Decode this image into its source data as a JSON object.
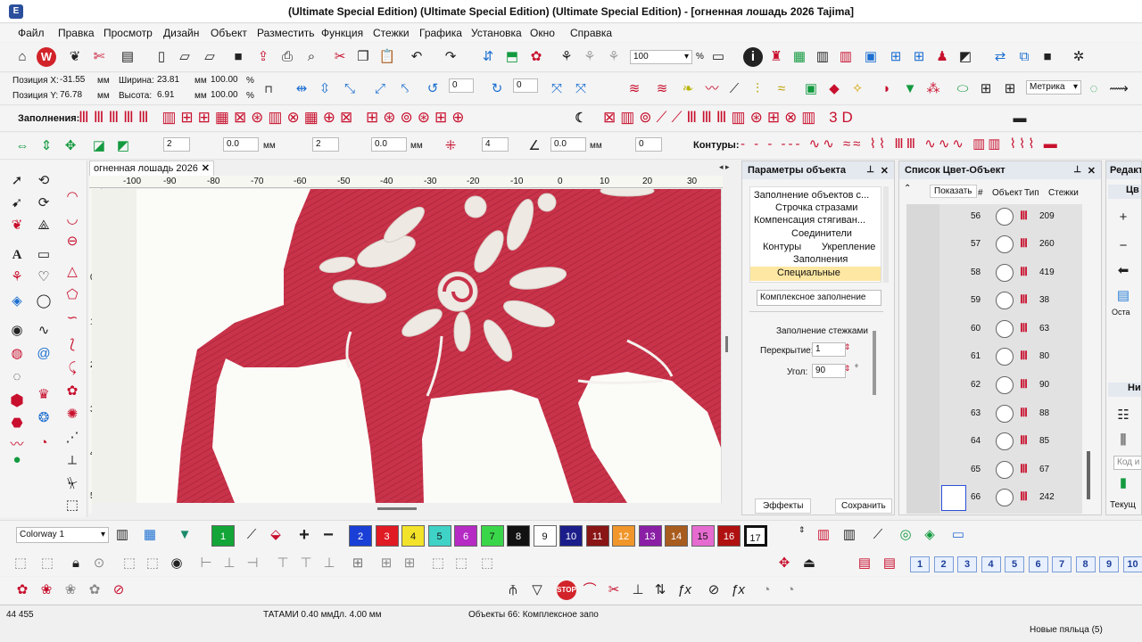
{
  "title": {
    "text": "(Ultimate Special Edition) (Ultimate Special Edition) (Ultimate Special Edition) - [огненная лошадь 2026     Tajima]"
  },
  "menu": [
    "Файл",
    "Правка",
    "Просмотр",
    "Дизайн",
    "Объект",
    "Разместить",
    "Функция",
    "Стежки",
    "Графика",
    "Установка",
    "Окно",
    "Справка"
  ],
  "zoom": "100",
  "zoom_unit": "%",
  "position": {
    "x_label": "Позиция X:",
    "x": "-31.55",
    "x_unit": "мм",
    "y_label": "Позиция Y:",
    "y": "76.78",
    "y_unit": "мм",
    "w_label": "Ширина:",
    "w": "23.81",
    "w_unit": "мм",
    "w_pct": "100.00",
    "w_pct_unit": "%",
    "h_label": "Высота:",
    "h": "6.91",
    "h_unit": "мм",
    "h_pct": "100.00",
    "h_pct_unit": "%"
  },
  "rotate_fields": [
    "0",
    "0"
  ],
  "metric": "Метрика",
  "fills_label": "Заполнения:",
  "contours_label": "Контуры:",
  "row4_fields": [
    "2",
    "0.0",
    "2",
    "0.0",
    "4",
    "0.0",
    "0"
  ],
  "row4_units": [
    "мм",
    "мм",
    "мм"
  ],
  "canvas": {
    "tab": "огненная лошадь 2026",
    "ruler_top": [
      "-100",
      "-90",
      "-80",
      "-70",
      "-60",
      "-50",
      "-40",
      "-30",
      "-20",
      "-10",
      "0",
      "10",
      "20",
      "30"
    ],
    "ruler_left": [
      "0",
      "10",
      "20",
      "30",
      "40",
      "50"
    ]
  },
  "params_panel": {
    "title": "Параметры объекта",
    "items": [
      "Заполнение объектов с...",
      "Строчка стразами",
      "Компенсация стягиван...",
      "Соединители",
      "Контуры",
      "Укрепление",
      "Заполнения",
      "Специальные"
    ],
    "fill_type": "Комплексное заполнение",
    "section": "Заполнение стежками",
    "overlap_label": "Перекрытие:",
    "overlap": "1",
    "angle_label": "Угол:",
    "angle": "90",
    "angle_unit": "°",
    "effects": "Эффекты",
    "save": "Сохранить"
  },
  "color_list": {
    "title": "Список Цвет-Объект",
    "show": "Показать",
    "headers": [
      "#",
      "Объект",
      "Тип",
      "Стежки"
    ],
    "rows": [
      {
        "num": "56",
        "stitches": "209"
      },
      {
        "num": "57",
        "stitches": "260"
      },
      {
        "num": "58",
        "stitches": "419"
      },
      {
        "num": "59",
        "stitches": "38"
      },
      {
        "num": "60",
        "stitches": "63"
      },
      {
        "num": "61",
        "stitches": "80"
      },
      {
        "num": "62",
        "stitches": "90"
      },
      {
        "num": "63",
        "stitches": "88"
      },
      {
        "num": "64",
        "stitches": "85"
      },
      {
        "num": "65",
        "stitches": "67"
      },
      {
        "num": "66",
        "stitches": "242"
      }
    ]
  },
  "edit_panel": {
    "title": "Редакт",
    "section1": "Цв",
    "rest": "Оста",
    "section2": "Нит",
    "code_placeholder": "Код и",
    "current": "Текущ"
  },
  "colorway": "Colorway 1",
  "palette": [
    {
      "n": "1",
      "c": "#13a538"
    },
    {
      "n": "2",
      "c": "#1a3fd6"
    },
    {
      "n": "3",
      "c": "#e01b24"
    },
    {
      "n": "4",
      "c": "#f2e32a"
    },
    {
      "n": "5",
      "c": "#3fd2c7"
    },
    {
      "n": "6",
      "c": "#b52bc4"
    },
    {
      "n": "7",
      "c": "#3ad64a"
    },
    {
      "n": "8",
      "c": "#111111"
    },
    {
      "n": "9",
      "c": "#ffffff"
    },
    {
      "n": "10",
      "c": "#1b1e8a"
    },
    {
      "n": "11",
      "c": "#8a1515"
    },
    {
      "n": "12",
      "c": "#f0962a"
    },
    {
      "n": "13",
      "c": "#8a1fa6"
    },
    {
      "n": "14",
      "c": "#a85c1e"
    },
    {
      "n": "15",
      "c": "#e66bd0"
    },
    {
      "n": "16",
      "c": "#b01010"
    },
    {
      "n": "17",
      "c": "#ffffff"
    }
  ],
  "seq_numbers": [
    "1",
    "2",
    "3",
    "4",
    "5",
    "6",
    "7",
    "8",
    "9",
    "10"
  ],
  "status": {
    "count": "44 455",
    "stitch": "ТАТАМИ  0.40 ммДл.  4.00 мм",
    "objects": "Объекты 66: Комплексное запо",
    "hoop": "Новые пяльца (5)"
  },
  "colors": {
    "fabric_red": "#c8334a",
    "accent": "#e6b800"
  }
}
